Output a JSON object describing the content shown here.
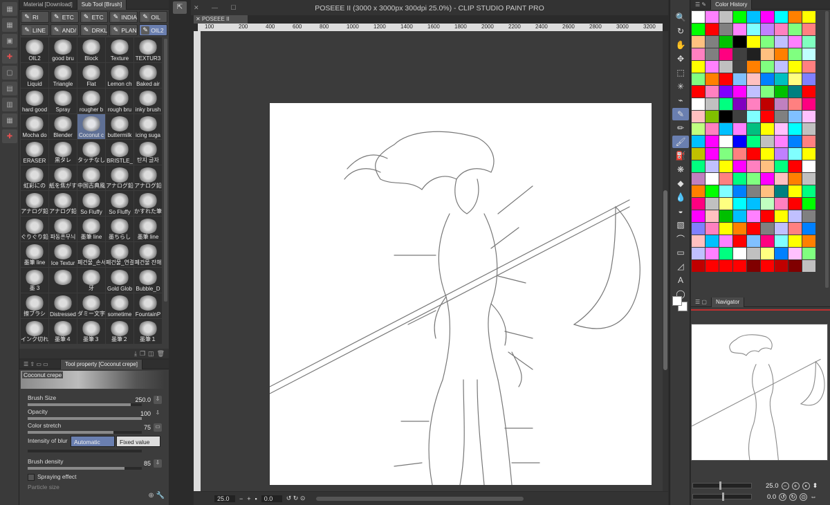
{
  "window_title": "POSEEE II (3000 x 3000px 300dpi 25.0%)  - CLIP STUDIO PAINT PRO",
  "doc_tab": "POSEEE II",
  "panels": {
    "material_tab": "Material [Download]",
    "subtool_tab": "Sub Tool [Brush]",
    "toolprop_tab": "Tool property [Coconut crepe]",
    "color_history_tab": "Color History",
    "navigator_tab": "Navigator"
  },
  "brush_groups": [
    {
      "label": "RI"
    },
    {
      "label": "ETC"
    },
    {
      "label": "ETC"
    },
    {
      "label": "INDIA"
    },
    {
      "label": "OIL"
    },
    {
      "label": "LINE"
    },
    {
      "label": "AND/"
    },
    {
      "label": "DRKL"
    },
    {
      "label": "PLAN"
    },
    {
      "label": "OIL2"
    }
  ],
  "brushes": [
    "OIL2",
    "good bru",
    "Block",
    "Texture",
    "TEXTUR3",
    "Liquid",
    "Triangle",
    "Flat",
    "Lemon ch",
    "Baked air",
    "hard good",
    "Spray",
    "rougher b",
    "rough bru",
    "inky brush",
    "Mocha do",
    "Blender",
    "Coconut c",
    "buttermilk",
    "icing suga",
    "ERASER",
    "黒タレ",
    "タッチなし",
    "BRISTLE_",
    "탄지 글자",
    "虹彩にの",
    "紙を焦がす",
    "中国古典風",
    "アナログ鉛",
    "アナログ鉛",
    "アナログ鉛",
    "アナログ鉛",
    "So Fluffy",
    "So Fluffy",
    "かすれた筆",
    "ぐりぐり鉛",
    "파동흔무늬",
    "墨筆 line",
    "墨ちらし",
    "墨筆 line",
    "墨筆 line",
    "Ice Textur",
    "폐건물_손서",
    "폐건물_연결",
    "폐건물 잔해",
    "墨 3",
    "",
    "牙",
    "Gold Glob",
    "Bubble_D",
    "擦ブラシ",
    "Distressed",
    "ダミー文字",
    "sometime",
    "FountainP",
    "インク切れ",
    "墨筆４",
    "墨筆３",
    "墨筆２",
    "墨筆１"
  ],
  "selected_brush_index": 17,
  "tool_property": {
    "brush_name": "Coconut crepe",
    "brush_size_label": "Brush Size",
    "brush_size_value": "250.0",
    "opacity_label": "Opacity",
    "opacity_value": "100",
    "color_stretch_label": "Color stretch",
    "color_stretch_value": "75",
    "intensity_label": "Intensity of blur",
    "automatic_label": "Automatic",
    "fixed_label": "Fixed value",
    "density_label": "Brush density",
    "density_value": "85",
    "spraying_label": "Spraying effect",
    "particle_label": "Particle size"
  },
  "ruler_top": [
    "100",
    "200",
    "400",
    "600",
    "800",
    "1000",
    "1200",
    "1400",
    "1600",
    "1800",
    "2000",
    "2200",
    "2400",
    "2600",
    "2800",
    "3000",
    "3200"
  ],
  "status": {
    "zoom": "25.0",
    "rotation": "0.0"
  },
  "navigator": {
    "zoom": "25.0",
    "rotation": "0.0"
  },
  "colors": {
    "accent": "#6a7fb0",
    "swatches": [
      "#ffffff",
      "#ff80ff",
      "#c0c0c0",
      "#00ff00",
      "#00c0ff",
      "#ff00ff",
      "#00ffff",
      "#ff8000",
      "#ffff00",
      "#00ff00",
      "#ff0000",
      "#808080",
      "#ff80ff",
      "#80ffff",
      "#c080ff",
      "#ff80c0",
      "#80ff80",
      "#ff8080",
      "#ffc080",
      "#808080",
      "#00c000",
      "#000000",
      "#ffff00",
      "#80ff80",
      "#c0c0ff",
      "#ff80ff",
      "#80ffc0",
      "#ff80c0",
      "#808080",
      "#ff0080",
      "#404040",
      "#202020",
      "#ffc080",
      "#ff8000",
      "#80ff80",
      "#c0ffff",
      "#ffff00",
      "#ff80ff",
      "#c0c0c0",
      "#404040",
      "#ff8000",
      "#80ff80",
      "#c0c0ff",
      "#ffff00",
      "#ff8080",
      "#80ff80",
      "#ff8000",
      "#ff0000",
      "#80c0ff",
      "#ffc0c0",
      "#0080ff",
      "#00c0c0",
      "#ffff80",
      "#8080ff",
      "#ff0000",
      "#ff80c0",
      "#8000ff",
      "#ff00ff",
      "#c0c0ff",
      "#80ff80",
      "#00c000",
      "#008080",
      "#ff0000",
      "#ffffff",
      "#c0c0c0",
      "#00ff80",
      "#8000c0",
      "#ff80c0",
      "#c00000",
      "#c080c0",
      "#ff8080",
      "#ff0080",
      "#ffc0c0",
      "#80c000",
      "#000000",
      "#404040",
      "#80ffff",
      "#ff0000",
      "#808080",
      "#80c0ff",
      "#ffc0ff",
      "#c0ff80",
      "#ff80c0",
      "#00c0ff",
      "#ff80ff",
      "#00c080",
      "#ffff00",
      "#ffc0ff",
      "#00ffff",
      "#c0c0c0",
      "#00c0ff",
      "#ff00ff",
      "#ffffff",
      "#0000ff",
      "#00ff80",
      "#c0c0c0",
      "#ff80ff",
      "#0080ff",
      "#ff8080",
      "#c0c000",
      "#ff00ff",
      "#80ff80",
      "#ff8080",
      "#ff0000",
      "#ffff00",
      "#c080ff",
      "#80ffff",
      "#ffff00",
      "#00ff80",
      "#c0c0ff",
      "#ffff00",
      "#ff00ff",
      "#ff80c0",
      "#ffc080",
      "#00ff80",
      "#ff0000",
      "#ffffff",
      "#c080c0",
      "#ffffff",
      "#ff8080",
      "#00ff80",
      "#80ff80",
      "#ff00ff",
      "#ffc0c0",
      "#ff8000",
      "#c0c0c0",
      "#ff8000",
      "#00ff00",
      "#80ffff",
      "#0080ff",
      "#808080",
      "#ffc080",
      "#008080",
      "#ffff00",
      "#00ff80",
      "#ff0080",
      "#c0c0c0",
      "#ffff80",
      "#00ffff",
      "#00c0ff",
      "#c0ffc0",
      "#ff80c0",
      "#ff0000",
      "#00ff00",
      "#ff00ff",
      "#ffc0c0",
      "#00c000",
      "#00c0ff",
      "#ff80ff",
      "#ff0000",
      "#ffff00",
      "#c0c0ff",
      "#808080",
      "#8080ff",
      "#ff80c0",
      "#ffff00",
      "#ff8000",
      "#ff0000",
      "#808080",
      "#c0c0ff",
      "#ff8080",
      "#0080ff",
      "#ffc0c0",
      "#00c0ff",
      "#ff80ff",
      "#ff0000",
      "#80c0ff",
      "#ff0080",
      "#80ffff",
      "#ffff00",
      "#ff8000",
      "#c0c0ff",
      "#ff80ff",
      "#00ff80",
      "#ffffff",
      "#c0c0c0",
      "#ffff80",
      "#0080ff",
      "#ffc0ff",
      "#80ff80",
      "#c00000",
      "#ff0000",
      "#ff0000",
      "#ff0000",
      "#800000",
      "#ff0000",
      "#c00000",
      "#800000",
      "#c0c0c0"
    ]
  }
}
